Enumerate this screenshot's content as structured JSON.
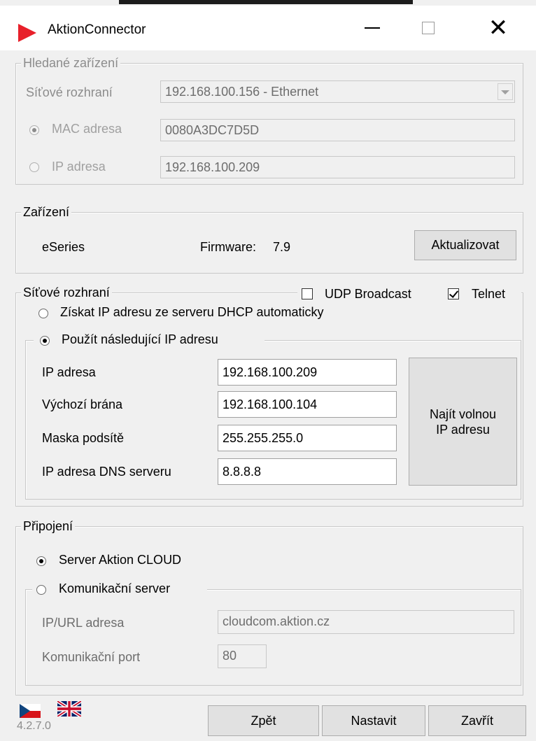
{
  "window": {
    "title": "AktionConnector",
    "minimize_icon": "minimize-icon",
    "maximize_icon": "maximize-icon",
    "close_icon": "close-icon",
    "accent": "#e8202a"
  },
  "search_group": {
    "legend": "Hledané zařízení",
    "interface_label": "Síťové rozhraní",
    "interface_value": "192.168.100.156 - Ethernet",
    "mac_label": "MAC adresa",
    "mac_value": "0080A3DC7D5D",
    "mac_selected": true,
    "ip_label": "IP adresa",
    "ip_value": "192.168.100.209",
    "ip_selected": false
  },
  "device_group": {
    "legend": "Zařízení",
    "model": "eSeries",
    "firmware_label": "Firmware:",
    "firmware_value": "7.9",
    "update_button": "Aktualizovat"
  },
  "network_group": {
    "legend": "Síťové rozhraní",
    "udp_broadcast_label": "UDP Broadcast",
    "udp_broadcast_checked": false,
    "telnet_label": "Telnet",
    "telnet_checked": true,
    "dhcp_label": "Získat IP adresu ze serveru DHCP automaticky",
    "dhcp_selected": false,
    "static_label": "Použít následující IP adresu",
    "static_selected": true,
    "ip_label": "IP adresa",
    "ip_value": "192.168.100.209",
    "gateway_label": "Výchozí brána",
    "gateway_value": "192.168.100.104",
    "mask_label": "Maska podsítě",
    "mask_value": "255.255.255.0",
    "dns_label": "IP adresa DNS serveru",
    "dns_value": "8.8.8.8",
    "find_button_line1": "Najít volnou",
    "find_button_line2": "IP adresu"
  },
  "connection_group": {
    "legend": "Připojení",
    "cloud_label": "Server Aktion CLOUD",
    "cloud_selected": true,
    "comm_label": "Komunikační server",
    "comm_selected": false,
    "url_label": "IP/URL adresa",
    "url_value": "cloudcom.aktion.cz",
    "port_label": "Komunikační port",
    "port_value": "80"
  },
  "footer": {
    "flags": [
      "czech-flag-icon",
      "uk-flag-icon"
    ],
    "version": "4.2.7.0",
    "back_button": "Zpět",
    "set_button": "Nastavit",
    "close_button": "Zavřít"
  }
}
